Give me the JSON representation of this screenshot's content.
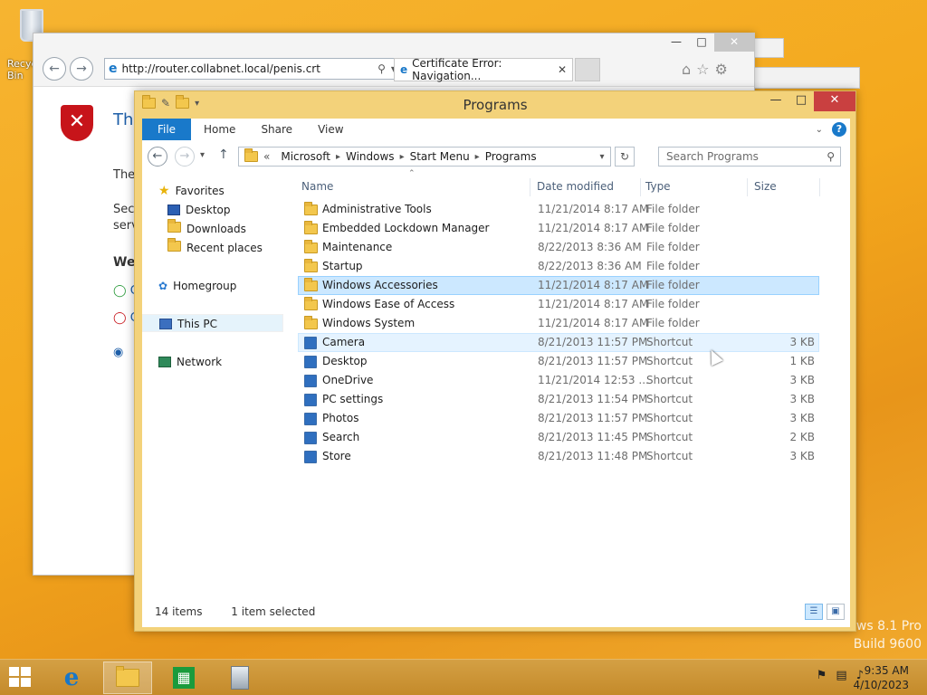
{
  "desktop": {
    "recycle_label": "Recycle Bin",
    "watermark_line1": "ws 8.1 Pro",
    "watermark_line2": "Build 9600"
  },
  "ie": {
    "address": "http://router.collabnet.local/penis.crt",
    "tab_title": "Certificate Error: Navigation...",
    "heading": "The",
    "text1": "The",
    "text2": "Secu",
    "text3": "serv",
    "text4": "We",
    "text5": "C",
    "text6": "C"
  },
  "explorer": {
    "title": "Programs",
    "ribbon": {
      "file": "File",
      "home": "Home",
      "share": "Share",
      "view": "View"
    },
    "breadcrumb": [
      "Microsoft",
      "Windows",
      "Start Menu",
      "Programs"
    ],
    "breadcrumb_prefix": "«",
    "search_placeholder": "Search Programs",
    "nav": {
      "favorites": "Favorites",
      "desktop": "Desktop",
      "downloads": "Downloads",
      "recent": "Recent places",
      "homegroup": "Homegroup",
      "thispc": "This PC",
      "network": "Network"
    },
    "columns": {
      "name": "Name",
      "date": "Date modified",
      "type": "Type",
      "size": "Size"
    },
    "rows": [
      {
        "name": "Administrative Tools",
        "date": "11/21/2014 8:17 AM",
        "type": "File folder",
        "size": ""
      },
      {
        "name": "Embedded Lockdown Manager",
        "date": "11/21/2014 8:17 AM",
        "type": "File folder",
        "size": ""
      },
      {
        "name": "Maintenance",
        "date": "8/22/2013 8:36 AM",
        "type": "File folder",
        "size": ""
      },
      {
        "name": "Startup",
        "date": "8/22/2013 8:36 AM",
        "type": "File folder",
        "size": ""
      },
      {
        "name": "Windows Accessories",
        "date": "11/21/2014 8:17 AM",
        "type": "File folder",
        "size": ""
      },
      {
        "name": "Windows Ease of Access",
        "date": "11/21/2014 8:17 AM",
        "type": "File folder",
        "size": ""
      },
      {
        "name": "Windows System",
        "date": "11/21/2014 8:17 AM",
        "type": "File folder",
        "size": ""
      },
      {
        "name": "Camera",
        "date": "8/21/2013 11:57 PM",
        "type": "Shortcut",
        "size": "3 KB"
      },
      {
        "name": "Desktop",
        "date": "8/21/2013 11:57 PM",
        "type": "Shortcut",
        "size": "1 KB"
      },
      {
        "name": "OneDrive",
        "date": "11/21/2014 12:53 ...",
        "type": "Shortcut",
        "size": "3 KB"
      },
      {
        "name": "PC settings",
        "date": "8/21/2013 11:54 PM",
        "type": "Shortcut",
        "size": "3 KB"
      },
      {
        "name": "Photos",
        "date": "8/21/2013 11:57 PM",
        "type": "Shortcut",
        "size": "3 KB"
      },
      {
        "name": "Search",
        "date": "8/21/2013 11:45 PM",
        "type": "Shortcut",
        "size": "2 KB"
      },
      {
        "name": "Store",
        "date": "8/21/2013 11:48 PM",
        "type": "Shortcut",
        "size": "3 KB"
      }
    ],
    "status_items": "14 items",
    "status_selected": "1 item selected"
  },
  "taskbar": {
    "time": "9:35 AM",
    "date": "4/10/2023"
  },
  "colors": {
    "accent": "#1979ca",
    "selected_row": "#cce8ff",
    "window_frame": "#f3d27a"
  }
}
